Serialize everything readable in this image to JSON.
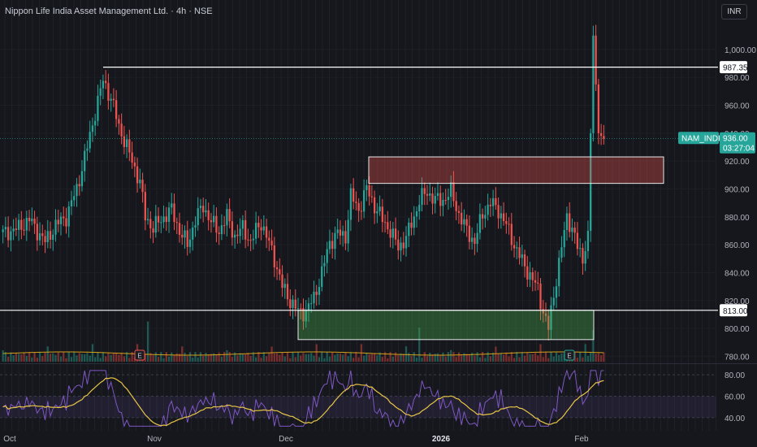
{
  "header": {
    "title": "Nippon Life India Asset Management Ltd. · 4h · NSE",
    "currency": "INR"
  },
  "price_labels": {
    "resistance": "987.35",
    "support": "813.00",
    "symbol": "NAM_INDIA",
    "last": "936.00",
    "countdown": "03:27:04"
  },
  "markers": {
    "earnings": "E"
  },
  "colors": {
    "up": "#26a69a",
    "down": "#ef5350",
    "rsi": "#7e57c2",
    "rsi_ma": "#e8c547",
    "volume_ma": "#d4a017"
  },
  "chart_data": {
    "type": "candlestick",
    "title": "Nippon Life India Asset Management Ltd. · 4h · NSE",
    "price_axis": {
      "ylim": [
        775,
        1025
      ],
      "ticks": [
        780,
        800,
        820,
        840,
        860,
        880,
        900,
        920,
        940,
        960,
        980,
        1000
      ],
      "tick_labels": [
        "780.00",
        "800.00",
        "820.00",
        "840.00",
        "860.00",
        "880.00",
        "900.00",
        "920.00",
        "940.00",
        "960.00",
        "980.00",
        "1,000.00"
      ]
    },
    "x_tick_labels": [
      "Oct",
      "Nov",
      "Dec",
      "2026",
      "Feb"
    ],
    "levels": [
      {
        "label": "987.35",
        "value": 987.35
      },
      {
        "label": "813.00",
        "value": 813.0
      }
    ],
    "zones": [
      {
        "name": "supply",
        "y_range": [
          904,
          923
        ]
      },
      {
        "name": "demand",
        "y_range": [
          792,
          813
        ]
      }
    ],
    "last_price": 936.0,
    "close_path": [
      [
        0,
        868
      ],
      [
        6,
        872
      ],
      [
        10,
        878
      ],
      [
        13,
        870
      ],
      [
        16,
        862
      ],
      [
        20,
        874
      ],
      [
        24,
        880
      ],
      [
        28,
        900
      ],
      [
        32,
        930
      ],
      [
        35,
        955
      ],
      [
        38,
        978
      ],
      [
        41,
        965
      ],
      [
        44,
        945
      ],
      [
        48,
        925
      ],
      [
        52,
        905
      ],
      [
        54,
        880
      ],
      [
        57,
        872
      ],
      [
        60,
        878
      ],
      [
        64,
        885
      ],
      [
        67,
        870
      ],
      [
        70,
        860
      ],
      [
        73,
        878
      ],
      [
        76,
        888
      ],
      [
        79,
        876
      ],
      [
        82,
        870
      ],
      [
        85,
        880
      ],
      [
        88,
        866
      ],
      [
        91,
        872
      ],
      [
        94,
        862
      ],
      [
        96,
        870
      ],
      [
        98,
        876
      ],
      [
        100,
        866
      ],
      [
        103,
        850
      ],
      [
        106,
        830
      ],
      [
        109,
        820
      ],
      [
        112,
        812
      ],
      [
        115,
        812
      ],
      [
        118,
        822
      ],
      [
        121,
        840
      ],
      [
        124,
        862
      ],
      [
        127,
        868
      ],
      [
        130,
        866
      ],
      [
        132,
        895
      ],
      [
        135,
        885
      ],
      [
        138,
        900
      ],
      [
        141,
        888
      ],
      [
        144,
        878
      ],
      [
        147,
        870
      ],
      [
        150,
        858
      ],
      [
        153,
        865
      ],
      [
        156,
        880
      ],
      [
        158,
        892
      ],
      [
        161,
        898
      ],
      [
        164,
        892
      ],
      [
        167,
        892
      ],
      [
        170,
        898
      ],
      [
        173,
        882
      ],
      [
        176,
        870
      ],
      [
        179,
        862
      ],
      [
        182,
        882
      ],
      [
        185,
        890
      ],
      [
        188,
        885
      ],
      [
        191,
        874
      ],
      [
        194,
        860
      ],
      [
        197,
        848
      ],
      [
        200,
        838
      ],
      [
        203,
        828
      ],
      [
        205,
        812
      ],
      [
        207,
        800
      ],
      [
        208,
        812
      ],
      [
        210,
        836
      ],
      [
        212,
        858
      ],
      [
        214,
        880
      ],
      [
        216,
        872
      ],
      [
        218,
        858
      ],
      [
        220,
        850
      ],
      [
        222,
        870
      ],
      [
        224,
        1010
      ],
      [
        226,
        940
      ],
      [
        228,
        936
      ]
    ],
    "indicators": {
      "volume": {
        "ma_line": true,
        "earnings_markers": 2
      },
      "rsi": {
        "ylim": [
          30,
          90
        ],
        "ticks": [
          40,
          60,
          80
        ],
        "tick_labels": [
          "40.00",
          "60.00",
          "80.00"
        ],
        "band": [
          40,
          60
        ]
      }
    }
  }
}
